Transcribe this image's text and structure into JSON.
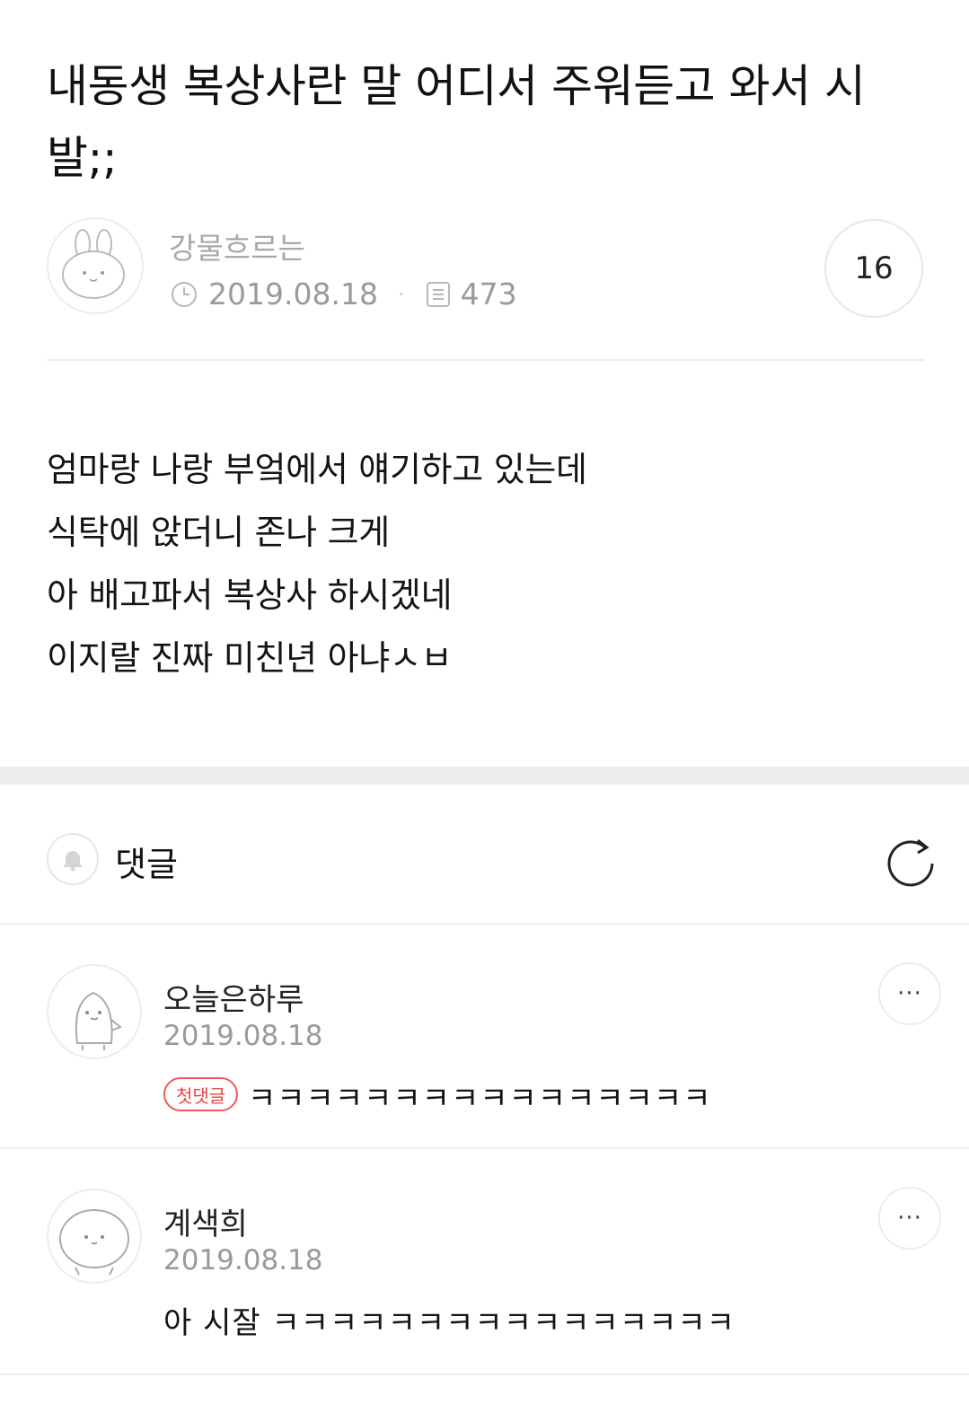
{
  "post": {
    "title": "내동생 복상사란 말 어디서 주워듣고 와서 시발;;",
    "author": "강물흐르는",
    "date": "2019.08.18",
    "views": "473",
    "comment_count": "16",
    "body_lines": [
      "엄마랑 나랑 부엌에서 얘기하고 있는데",
      "식탁에 앉더니 존나 크게",
      "아 배고파서 복상사 하시겠네",
      "이지랄 진짜 미친년 아냐ㅅㅂ"
    ]
  },
  "comments_section": {
    "label": "댓글",
    "icons": {
      "bell": "bell-icon",
      "refresh": "refresh-icon"
    }
  },
  "comments": [
    {
      "name": "오늘은하루",
      "date": "2019.08.18",
      "badge": "첫댓글",
      "text": "ㅋㅋㅋㅋㅋㅋㅋㅋㅋㅋㅋㅋㅋㅋㅋㅋ",
      "more": "···"
    },
    {
      "name": "계색희",
      "date": "2019.08.18",
      "text": "아 시잘 ㅋㅋㅋㅋㅋㅋㅋㅋㅋㅋㅋㅋㅋㅋㅋㅋ",
      "more": "···"
    }
  ],
  "colors": {
    "badge_red": "#e64545",
    "meta_gray": "#9a9a9a",
    "band_gray": "#eeeef0"
  }
}
